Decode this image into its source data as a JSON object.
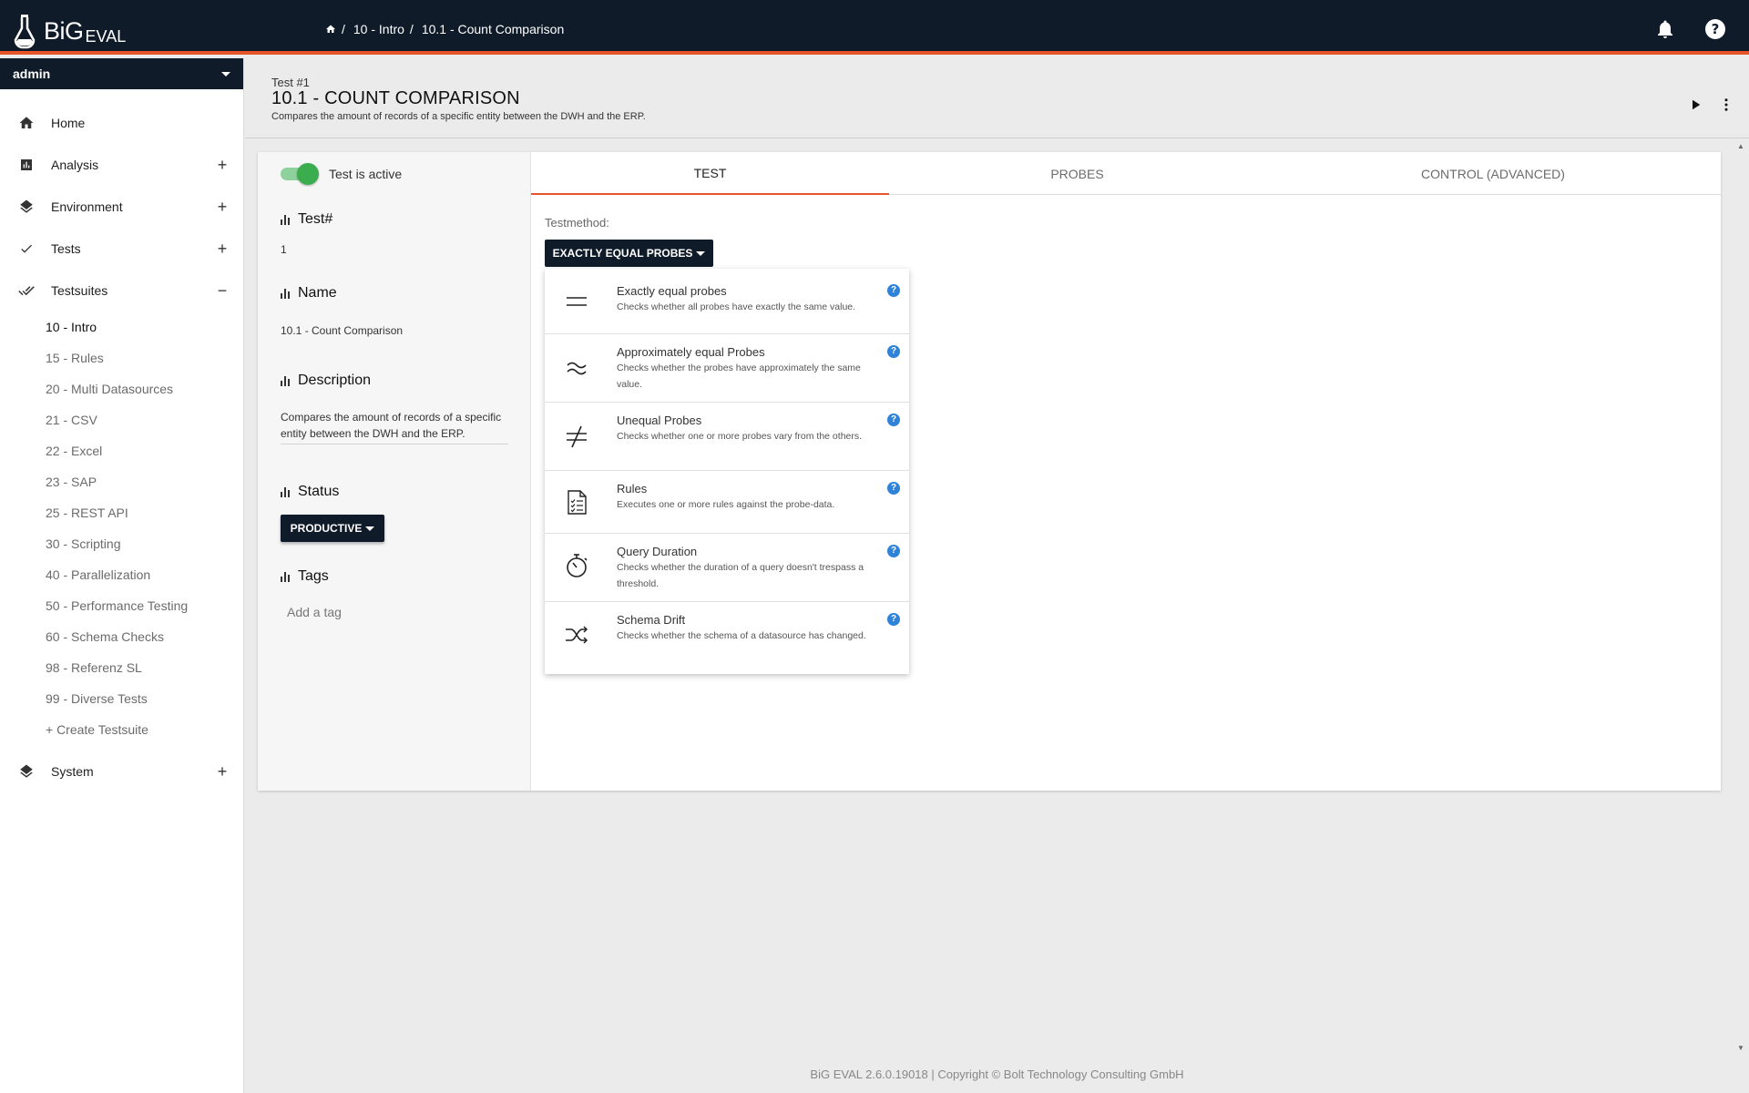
{
  "app": {
    "logo_big": "BiG",
    "logo_eval": "EVAL"
  },
  "breadcrumb": [
    {
      "label": "10 - Intro"
    },
    {
      "label": "10.1 - Count Comparison"
    }
  ],
  "breadcrumb_sep": "/",
  "user": {
    "name": "admin"
  },
  "nav": {
    "home": "Home",
    "analysis": "Analysis",
    "environment": "Environment",
    "tests": "Tests",
    "testsuites": "Testsuites",
    "system": "System",
    "expand_symbol": "+",
    "collapse_symbol": "−"
  },
  "testsuites": [
    "10 - Intro",
    "15 - Rules",
    "20 - Multi Datasources",
    "21 - CSV",
    "22 - Excel",
    "23 - SAP",
    "25 - REST API",
    "30 - Scripting",
    "40 - Parallelization",
    "50 - Performance Testing",
    "60 - Schema Checks",
    "98 - Referenz SL",
    "99 - Diverse Tests",
    "+ Create Testsuite"
  ],
  "header": {
    "kicker": "Test #1",
    "title": "10.1 - Count Comparison",
    "description": "Compares the amount of records of a specific entity between the DWH and the ERP."
  },
  "left": {
    "active_label": "Test is active",
    "test_no_label": "Test#",
    "test_no_value": "1",
    "name_label": "Name",
    "name_value": "10.1 - Count Comparison",
    "description_label": "Description",
    "description_value": "Compares the amount of records of a specific entity between the DWH and the ERP.",
    "status_label": "Status",
    "status_value": "PRODUCTIVE",
    "tags_label": "Tags",
    "tags_placeholder": "Add a tag"
  },
  "tabs": [
    "TEST",
    "PROBES",
    "CONTROL (ADVANCED)"
  ],
  "test": {
    "method_label": "Testmethod:",
    "method_value": "EXACTLY EQUAL PROBES"
  },
  "methods": [
    {
      "icon": "equals-icon",
      "title": "Exactly equal probes",
      "desc": "Checks whether all probes have exactly the same value."
    },
    {
      "icon": "approx-equal-icon",
      "title": "Approximately equal Probes",
      "desc": "Checks whether the probes have approximately the same value."
    },
    {
      "icon": "not-equal-icon",
      "title": "Unequal Probes",
      "desc": "Checks whether one or more probes vary from the others."
    },
    {
      "icon": "checklist-icon",
      "title": "Rules",
      "desc": "Executes one or more rules against the probe-data."
    },
    {
      "icon": "stopwatch-icon",
      "title": "Query Duration",
      "desc": "Checks whether the duration of a query doesn't trespass a threshold."
    },
    {
      "icon": "shuffle-icon",
      "title": "Schema Drift",
      "desc": "Checks whether the schema of a datasource has changed."
    }
  ],
  "help_symbol": "?",
  "footer": "BiG EVAL 2.6.0.19018 | Copyright © Bolt Technology Consulting GmbH",
  "colors": {
    "topbar": "#0f1b29",
    "accent": "#e8542a",
    "active_switch": "#3cad4e",
    "help": "#2f83d9"
  }
}
